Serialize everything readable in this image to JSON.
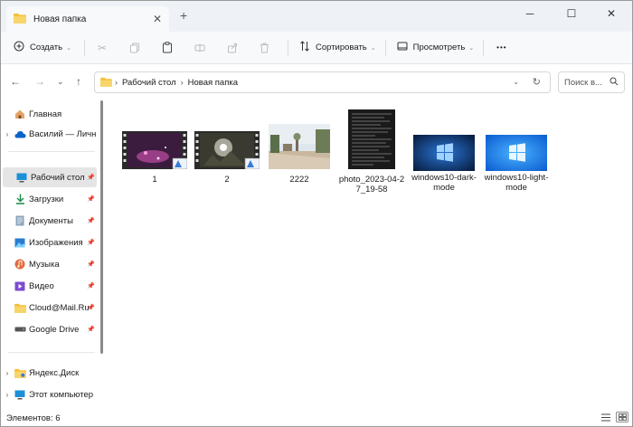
{
  "tab": {
    "title": "Новая папка",
    "close": "✕",
    "new_tab": "+"
  },
  "window_controls": {
    "minimize": "─",
    "maximize": "☐",
    "close": "✕"
  },
  "toolbar": {
    "create_label": "Создать",
    "sort_label": "Сортировать",
    "view_label": "Просмотреть",
    "more_label": "•••"
  },
  "address": {
    "crumbs": [
      "Рабочий стол",
      "Новая папка"
    ]
  },
  "search": {
    "placeholder": "Поиск в..."
  },
  "sidebar": {
    "items": [
      {
        "label": "Главная",
        "icon": "home-icon",
        "pinned": false,
        "chevron": ""
      },
      {
        "label": "Василий — Личный",
        "icon": "cloud-icon",
        "pinned": false,
        "chevron": "›"
      },
      {
        "label": "Рабочий стол",
        "icon": "desktop-icon",
        "pinned": true,
        "chevron": ""
      },
      {
        "label": "Загрузки",
        "icon": "download-icon",
        "pinned": true,
        "chevron": ""
      },
      {
        "label": "Документы",
        "icon": "documents-icon",
        "pinned": true,
        "chevron": ""
      },
      {
        "label": "Изображения",
        "icon": "pictures-icon",
        "pinned": true,
        "chevron": ""
      },
      {
        "label": "Музыка",
        "icon": "music-icon",
        "pinned": true,
        "chevron": ""
      },
      {
        "label": "Видео",
        "icon": "video-icon",
        "pinned": true,
        "chevron": ""
      },
      {
        "label": "Cloud@Mail.Ru",
        "icon": "folder-icon",
        "pinned": true,
        "chevron": ""
      },
      {
        "label": "Google Drive",
        "icon": "drive-icon",
        "pinned": true,
        "chevron": ""
      },
      {
        "label": "Яндекс.Диск",
        "icon": "yandex-disk-icon",
        "pinned": false,
        "chevron": "›"
      },
      {
        "label": "Этот компьютер",
        "icon": "computer-icon",
        "pinned": false,
        "chevron": "›"
      }
    ],
    "selected_index": 2
  },
  "files": [
    {
      "name": "1",
      "kind": "video"
    },
    {
      "name": "2",
      "kind": "video"
    },
    {
      "name": "2222",
      "kind": "photo"
    },
    {
      "name": "photo_2023-04-27_19-58",
      "kind": "document"
    },
    {
      "name": "windows10-dark-mode",
      "kind": "wallpaper-dark"
    },
    {
      "name": "windows10-light-mode",
      "kind": "wallpaper-light"
    }
  ],
  "status": {
    "items_label": "Элементов: 6"
  },
  "colors": {
    "accent": "#0067c0",
    "folder": "#f3c13a",
    "selected": "#e5e5e5"
  }
}
